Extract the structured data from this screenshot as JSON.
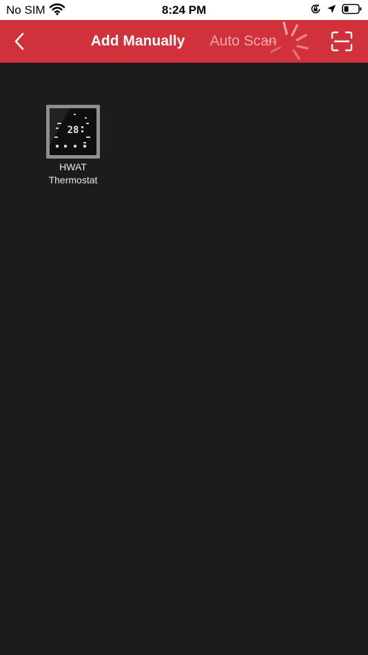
{
  "status_bar": {
    "carrier": "No SIM",
    "time": "8:24 PM"
  },
  "header": {
    "tabs": [
      {
        "label": "Add Manually",
        "selected": true
      },
      {
        "label": "Auto Scan",
        "selected": false
      }
    ]
  },
  "devices": [
    {
      "name_line1": "HWAT",
      "name_line2": "Thermostat",
      "display_value": "28"
    }
  ],
  "colors": {
    "header_bg": "#d1313b",
    "content_bg": "#1c1c1c",
    "tab_active": "#ffffff",
    "tab_inactive": "#f2a7ab"
  },
  "icons": [
    "wifi-icon",
    "orientation-lock-icon",
    "location-arrow-icon",
    "battery-icon",
    "back-chevron-icon",
    "loading-spinner-icon",
    "scan-frame-icon"
  ]
}
